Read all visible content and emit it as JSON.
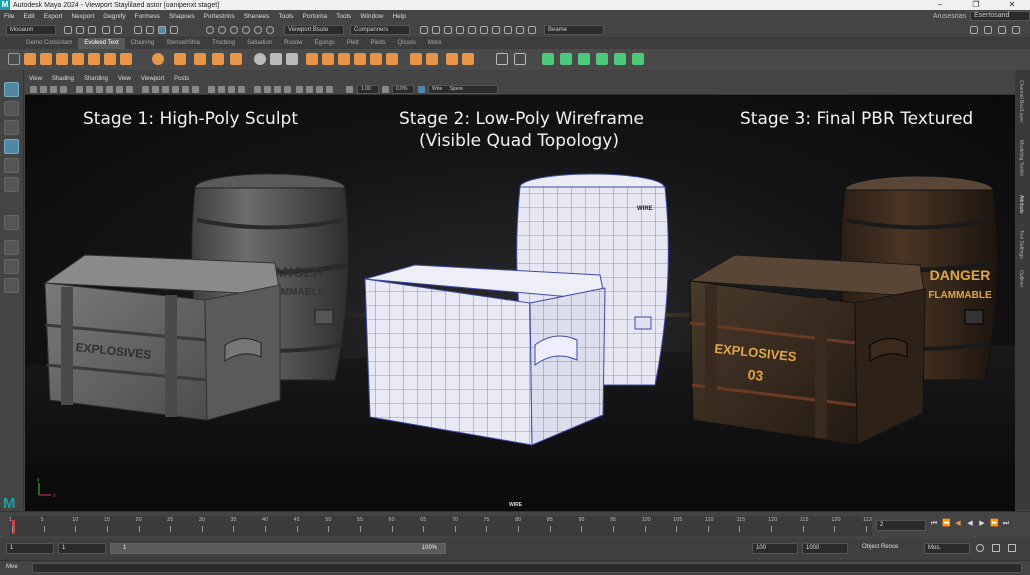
{
  "app": {
    "title": "Autodesk Maya 2024 - Viewport Staylilaed astor [oanipenxt staget]",
    "logo": "M",
    "window_buttons": [
      "–",
      "❐",
      "✕"
    ]
  },
  "menubar": {
    "items": [
      "File",
      "Edit",
      "Export",
      "Nexport",
      "Gegnify",
      "Formess",
      "Shapoes",
      "Portestrins",
      "Shenees",
      "Tools",
      "Portoma",
      "Tools",
      "Window",
      "Help"
    ],
    "workspace_label": "Arusesrias",
    "workspace_value": "Esertosand"
  },
  "statusline": {
    "mode": "Mooaum",
    "viewport_dropdown": "Viewport Bsute",
    "components": "Companners",
    "scene_dropdown": "Beame"
  },
  "shelf_tabs": {
    "active_index": 1,
    "items": [
      "Gemo Consistam",
      "Evoleed Text",
      "Chaining",
      "Stensel/Shia",
      "Trocbing",
      "Saluation",
      "Rusow",
      "Egongs",
      "Pielt",
      "Pieds",
      "Qisses",
      "More"
    ]
  },
  "viewport": {
    "menus": [
      "View",
      "Shading",
      "Sharding",
      "View",
      "Viewport",
      "Posts"
    ],
    "field_a": "1.00",
    "field_b": "0.0%",
    "shading_mode": "Wire",
    "shading_option": "Spere",
    "bottom_label": "WIRE",
    "stages": [
      {
        "line1": "Stage 1: High-Poly Sculpt",
        "line2": ""
      },
      {
        "line1": "Stage 2: Low-Poly Wireframe",
        "line2": "(Visible Quad Topology)"
      },
      {
        "line1": "Stage 3: Final PBR Textured",
        "line2": ""
      }
    ],
    "sculpt_texts": {
      "barrel": "DANGER",
      "barrel2": "FLAMMABLE",
      "crate": "EXPLOSIVES"
    },
    "wire_texts": {
      "barrel": "WIRE"
    },
    "pbr_texts": {
      "barrel": "DANGER",
      "barrel2": "FLAMMABLE",
      "crate": "EXPLOSIVES",
      "crate2": "03"
    },
    "axis": {
      "x": "x",
      "y": "y"
    }
  },
  "right_panel": {
    "tabs": [
      "Channel Box/Layer",
      "Modeling Toolkit",
      "Attribute",
      "Tool Settings",
      "Outliner"
    ]
  },
  "timeslider": {
    "ticks": [
      "1",
      "5",
      "10",
      "15",
      "20",
      "25",
      "30",
      "35",
      "40",
      "45",
      "50",
      "55",
      "60",
      "65",
      "70",
      "75",
      "80",
      "85",
      "90",
      "95",
      "100",
      "105",
      "110",
      "115",
      "120",
      "115",
      "120",
      "113"
    ],
    "current_frame": "2",
    "playback_buttons": [
      "⏮",
      "⏪",
      "◀",
      "▶",
      "⏩",
      "⏭"
    ]
  },
  "rangeslider": {
    "start": "1",
    "start2": "1",
    "slider_left": "1",
    "slider_pct": "100%",
    "end": "100",
    "end2": "1000",
    "object_label": "Object Rence",
    "mode": "Mos."
  },
  "cmdline": {
    "label": "Mee"
  },
  "colors": {
    "accent": "#5285a6",
    "maya_logo": "#1aa0a8",
    "shelf_orange": "#e8964a",
    "shelf_green": "#4ec97a"
  }
}
